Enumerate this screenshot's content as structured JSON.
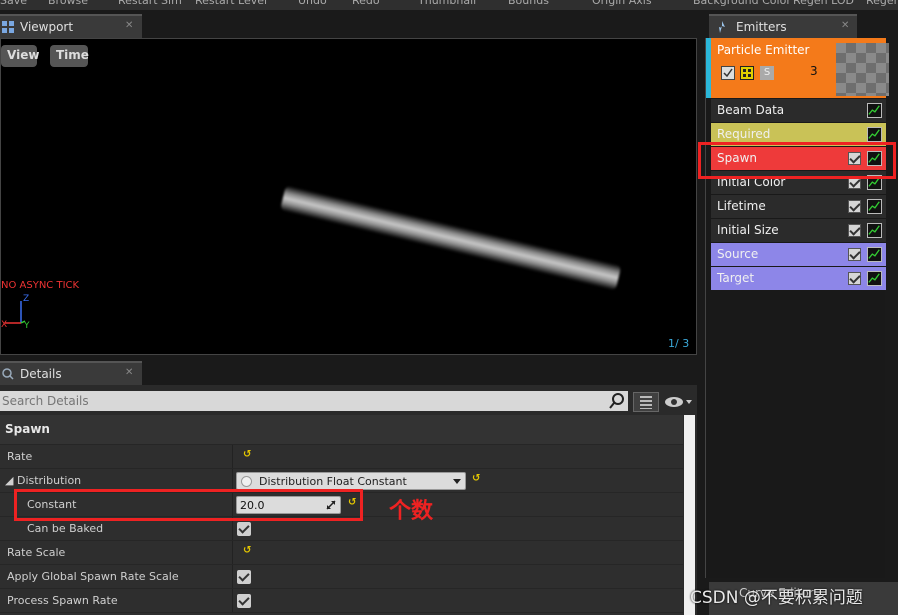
{
  "toolbar": {
    "items": [
      "Save",
      "Browse",
      "Restart Sim",
      "Restart Level",
      "Undo",
      "Redo",
      "Thumbnail",
      "Bounds",
      "Origin Axis",
      "Background Color",
      "Regen LOD",
      "Regen"
    ]
  },
  "viewport": {
    "tab_label": "Viewport",
    "view_button": "View",
    "time_button": "Time",
    "async_tick_text": "NO ASYNC TICK",
    "axis_z": "Z",
    "axis_x": "X",
    "axis_y": "Y",
    "frame_count": "1/ 3"
  },
  "details": {
    "tab_label": "Details",
    "search_placeholder": "Search Details",
    "category": "Spawn",
    "rows": {
      "rate": "Rate",
      "distribution": "Distribution",
      "distribution_value": "Distribution Float Constant",
      "constant": "Constant",
      "constant_value": "20.0",
      "can_be_baked": "Can be Baked",
      "rate_scale": "Rate Scale",
      "apply_global": "Apply Global Spawn Rate Scale",
      "process_spawn_rate": "Process Spawn Rate"
    }
  },
  "emitters": {
    "tab_label": "Emitters",
    "emitter_name": "Particle Emitter",
    "emitter_count": "3",
    "solo_label": "S",
    "modules": [
      {
        "label": "Beam Data",
        "color": "#2b2b2b",
        "has_check": false
      },
      {
        "label": "Required",
        "color": "#c9c257",
        "has_check": false
      },
      {
        "label": "Spawn",
        "color": "#ee3a3a",
        "has_check": true
      },
      {
        "label": "Initial Color",
        "color": "#2b2b2b",
        "has_check": true
      },
      {
        "label": "Lifetime",
        "color": "#2b2b2b",
        "has_check": true
      },
      {
        "label": "Initial Size",
        "color": "#2b2b2b",
        "has_check": true
      },
      {
        "label": "Source",
        "color": "#8d86e8",
        "has_check": true
      },
      {
        "label": "Target",
        "color": "#8d86e8",
        "has_check": true
      }
    ]
  },
  "annotation": {
    "text": "个数",
    "color": "#ee2222"
  },
  "curve_editor": {
    "label": "Curve Editor"
  },
  "watermark": "CSDN @不要积累问题"
}
